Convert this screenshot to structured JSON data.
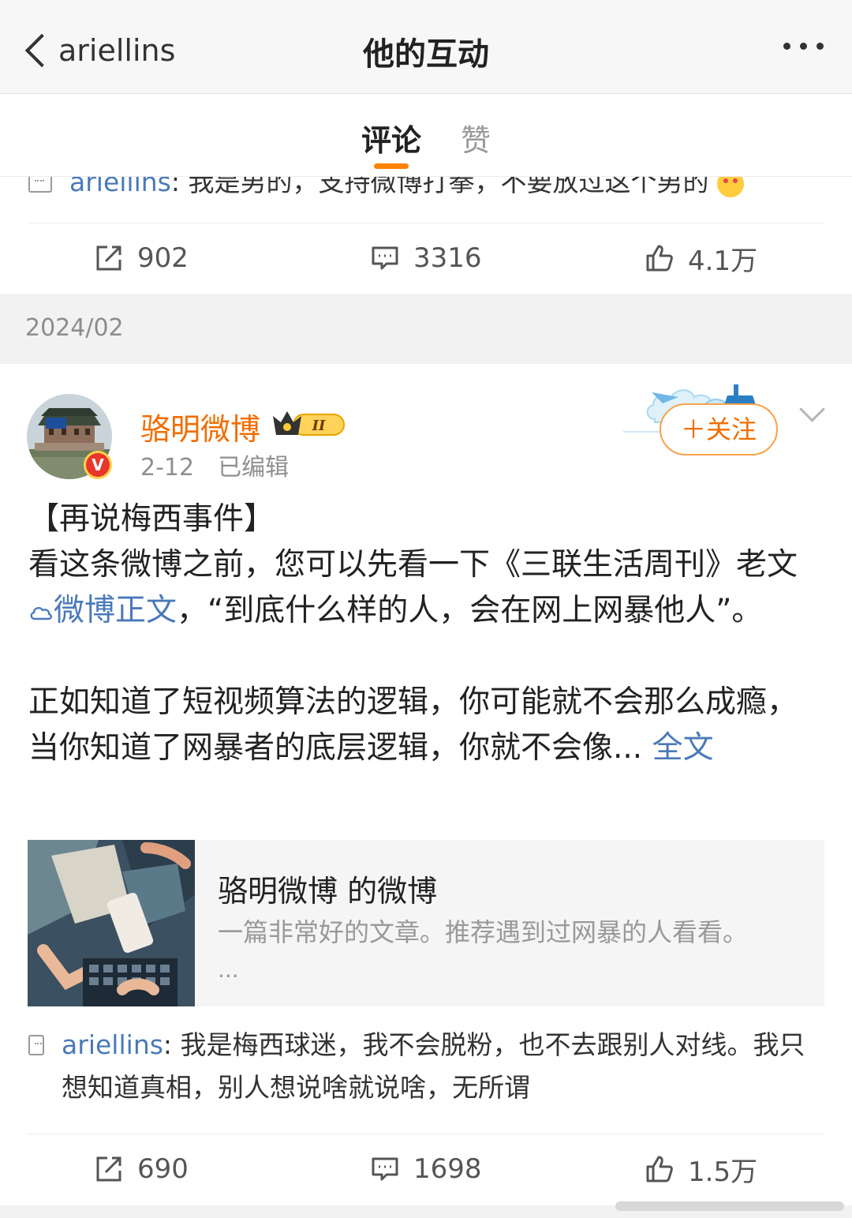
{
  "nav": {
    "back_label": "ariellins",
    "title": "他的互动"
  },
  "tabs": [
    {
      "label": "评论",
      "active": true
    },
    {
      "label": "赞",
      "active": false
    }
  ],
  "accent_color": "#ff8200",
  "prev_item": {
    "comment_user": "ariellins",
    "comment_text": ": 我是男的，支持微博打拳，不要放过这个男的",
    "shares": "902",
    "comments": "3316",
    "likes": "4.1万"
  },
  "date_separator": "2024/02",
  "post": {
    "author": "骆明微博",
    "verified_badge": "V",
    "level_badge": "II",
    "date": "2-12",
    "edited": "已编辑",
    "follow_label": "＋关注",
    "text_line1": "【再说梅西事件】",
    "text_seg1": "看这条微博之前，您可以先看一下《三联生活周刊》老文",
    "link_text": "微博正文",
    "text_seg2": "，“到底什么样的人，会在网上网暴他人”。",
    "text_para2": "正如知道了短视频算法的逻辑，你可能就不会那么成瘾，当你知道了网暴者的底层逻辑，你就不会像...",
    "full_text_label": "全文",
    "embed": {
      "title": "骆明微博 的微博",
      "desc": "一篇非常好的文章。推荐遇到过网暴的人看看。",
      "ellipsis": "..."
    },
    "comment_user": "ariellins",
    "comment_text": ": 我是梅西球迷，我不会脱粉，也不去跟别人对线。我只想知道真相，别人想说啥就说啥，无所谓",
    "shares": "690",
    "comments": "1698",
    "likes": "1.5万"
  }
}
